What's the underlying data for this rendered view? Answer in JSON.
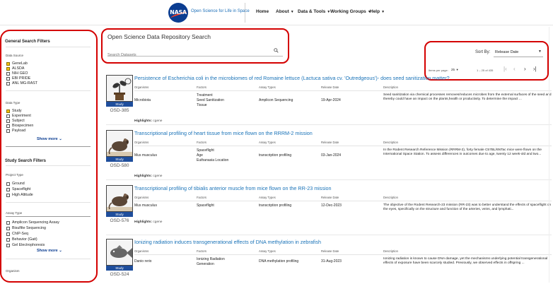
{
  "header": {
    "logo_text": "NASA",
    "site_title": "Open Science for Life in Space",
    "nav": [
      {
        "label": "Home",
        "has_menu": false
      },
      {
        "label": "About",
        "has_menu": true
      },
      {
        "label": "Data & Tools",
        "has_menu": true
      },
      {
        "label": "Working Groups",
        "has_menu": true
      },
      {
        "label": "Help",
        "has_menu": true
      }
    ]
  },
  "sidebar": {
    "general_title": "General Search Filters",
    "data_source": {
      "label": "Data Source",
      "items": [
        {
          "label": "GeneLab",
          "checked": true
        },
        {
          "label": "ALSDA",
          "checked": true
        },
        {
          "label": "NIH GEO",
          "checked": false
        },
        {
          "label": "EBI PRIDE",
          "checked": false
        },
        {
          "label": "ANL MG-RAST",
          "checked": false
        }
      ]
    },
    "data_type": {
      "label": "Data Type",
      "items": [
        {
          "label": "Study",
          "checked": true
        },
        {
          "label": "Experiment",
          "checked": false
        },
        {
          "label": "Subject",
          "checked": false
        },
        {
          "label": "Biospecimen",
          "checked": false
        },
        {
          "label": "Payload",
          "checked": false
        }
      ],
      "show_more": "Show more"
    },
    "study_title": "Study Search Filters",
    "project_type": {
      "label": "Project Type",
      "items": [
        {
          "label": "Ground",
          "checked": false
        },
        {
          "label": "Spaceflight",
          "checked": false
        },
        {
          "label": "High Altitude",
          "checked": false
        }
      ]
    },
    "assay_type": {
      "label": "Assay Type",
      "items": [
        {
          "label": "Amplicon Sequencing Assay",
          "checked": false
        },
        {
          "label": "Bisulfite Sequencing",
          "checked": false
        },
        {
          "label": "ChIP-Seq",
          "checked": false
        },
        {
          "label": "Behavior (Gait)",
          "checked": false
        },
        {
          "label": "Gel Electrophoresis",
          "checked": false
        }
      ],
      "show_more": "Show more"
    },
    "organism_label": "Organism"
  },
  "search": {
    "title": "Open Science Data Repository Search",
    "placeholder": "Search Datasets"
  },
  "sort": {
    "label": "Sort By:",
    "value": "Release Date",
    "items_per_page_label": "Items per page:",
    "items_per_page": "25",
    "range": "1 – 25 of 435"
  },
  "columns": [
    "Organisms",
    "Factors",
    "Assay Types",
    "Release Date",
    "Description"
  ],
  "highlights_label": "Highlights:",
  "results": [
    {
      "id": "OSD-385",
      "badge": "Study",
      "icon": "plant-icon",
      "title": "Persistence of Escherichia coli in the microbiomes of red Romaine lettuce (Lactuca sativa cv. 'Outredgeous')- does seed sanitization matter?",
      "organism": "Microbiota",
      "factors": [
        "Treatment",
        "Seed Sanitization",
        "Tissue"
      ],
      "assay": "Amplicon Sequencing",
      "date": "19-Apr-2024",
      "description": "Seed sanitization via chemical processes removes/reduces microbes from the external surfaces of the seed and thereby could have an impact on the plants,health or productivity. To determine the impact ...",
      "highlight": "cgene"
    },
    {
      "id": "OSD-580",
      "badge": "Study",
      "icon": "mouse-icon",
      "title": "Transcriptional profiling of heart tissue from mice flown on the RRRM-2 mission",
      "organism": "Mus musculus",
      "factors": [
        "Spaceflight",
        "Age",
        "Euthanasia Location"
      ],
      "assay": "transcription profiling",
      "date": "03-Jan-2024",
      "description": "In the Rodent Research Reference Mission (RRRM-2), forty female C57BL/6NTac mice were flown on the International Space Station. To assess differences in outcomes due to age, twenty 12 week-old and two...",
      "highlight": "cgene"
    },
    {
      "id": "OSD-576",
      "badge": "Study",
      "icon": "mouse-icon",
      "title": "Transcriptional profiling of tibialis anterior muscle from mice flown on the RR-23 mission",
      "organism": "Mus musculus",
      "factors": [
        "Spaceflight"
      ],
      "assay": "transcription profiling",
      "date": "12-Dec-2023",
      "description": "The objective of the Rodent Research-23 mission (RR-23) was to better understand the effects of spaceflight on the eyes, specifically on the structure and function of the arteries, veins, and lymphati...",
      "highlight": "cgene"
    },
    {
      "id": "OSD-524",
      "badge": "Study",
      "icon": "fish-icon",
      "title": "Ionizing radiation induces transgenerational effects of DNA methylation in zebrafish",
      "organism": "Danio rerio",
      "factors": [
        "Ionizing Radiation",
        "Generation"
      ],
      "assay": "DNA methylation profiling",
      "date": "31-Aug-2023",
      "description": "Ionizing radiation is known to cause DNA damage, yet the mechanisms underlying potential transgenerational effects of exposure have been scarcely studied. Previously, we observed effects in offspring ...",
      "highlight": ""
    }
  ]
}
